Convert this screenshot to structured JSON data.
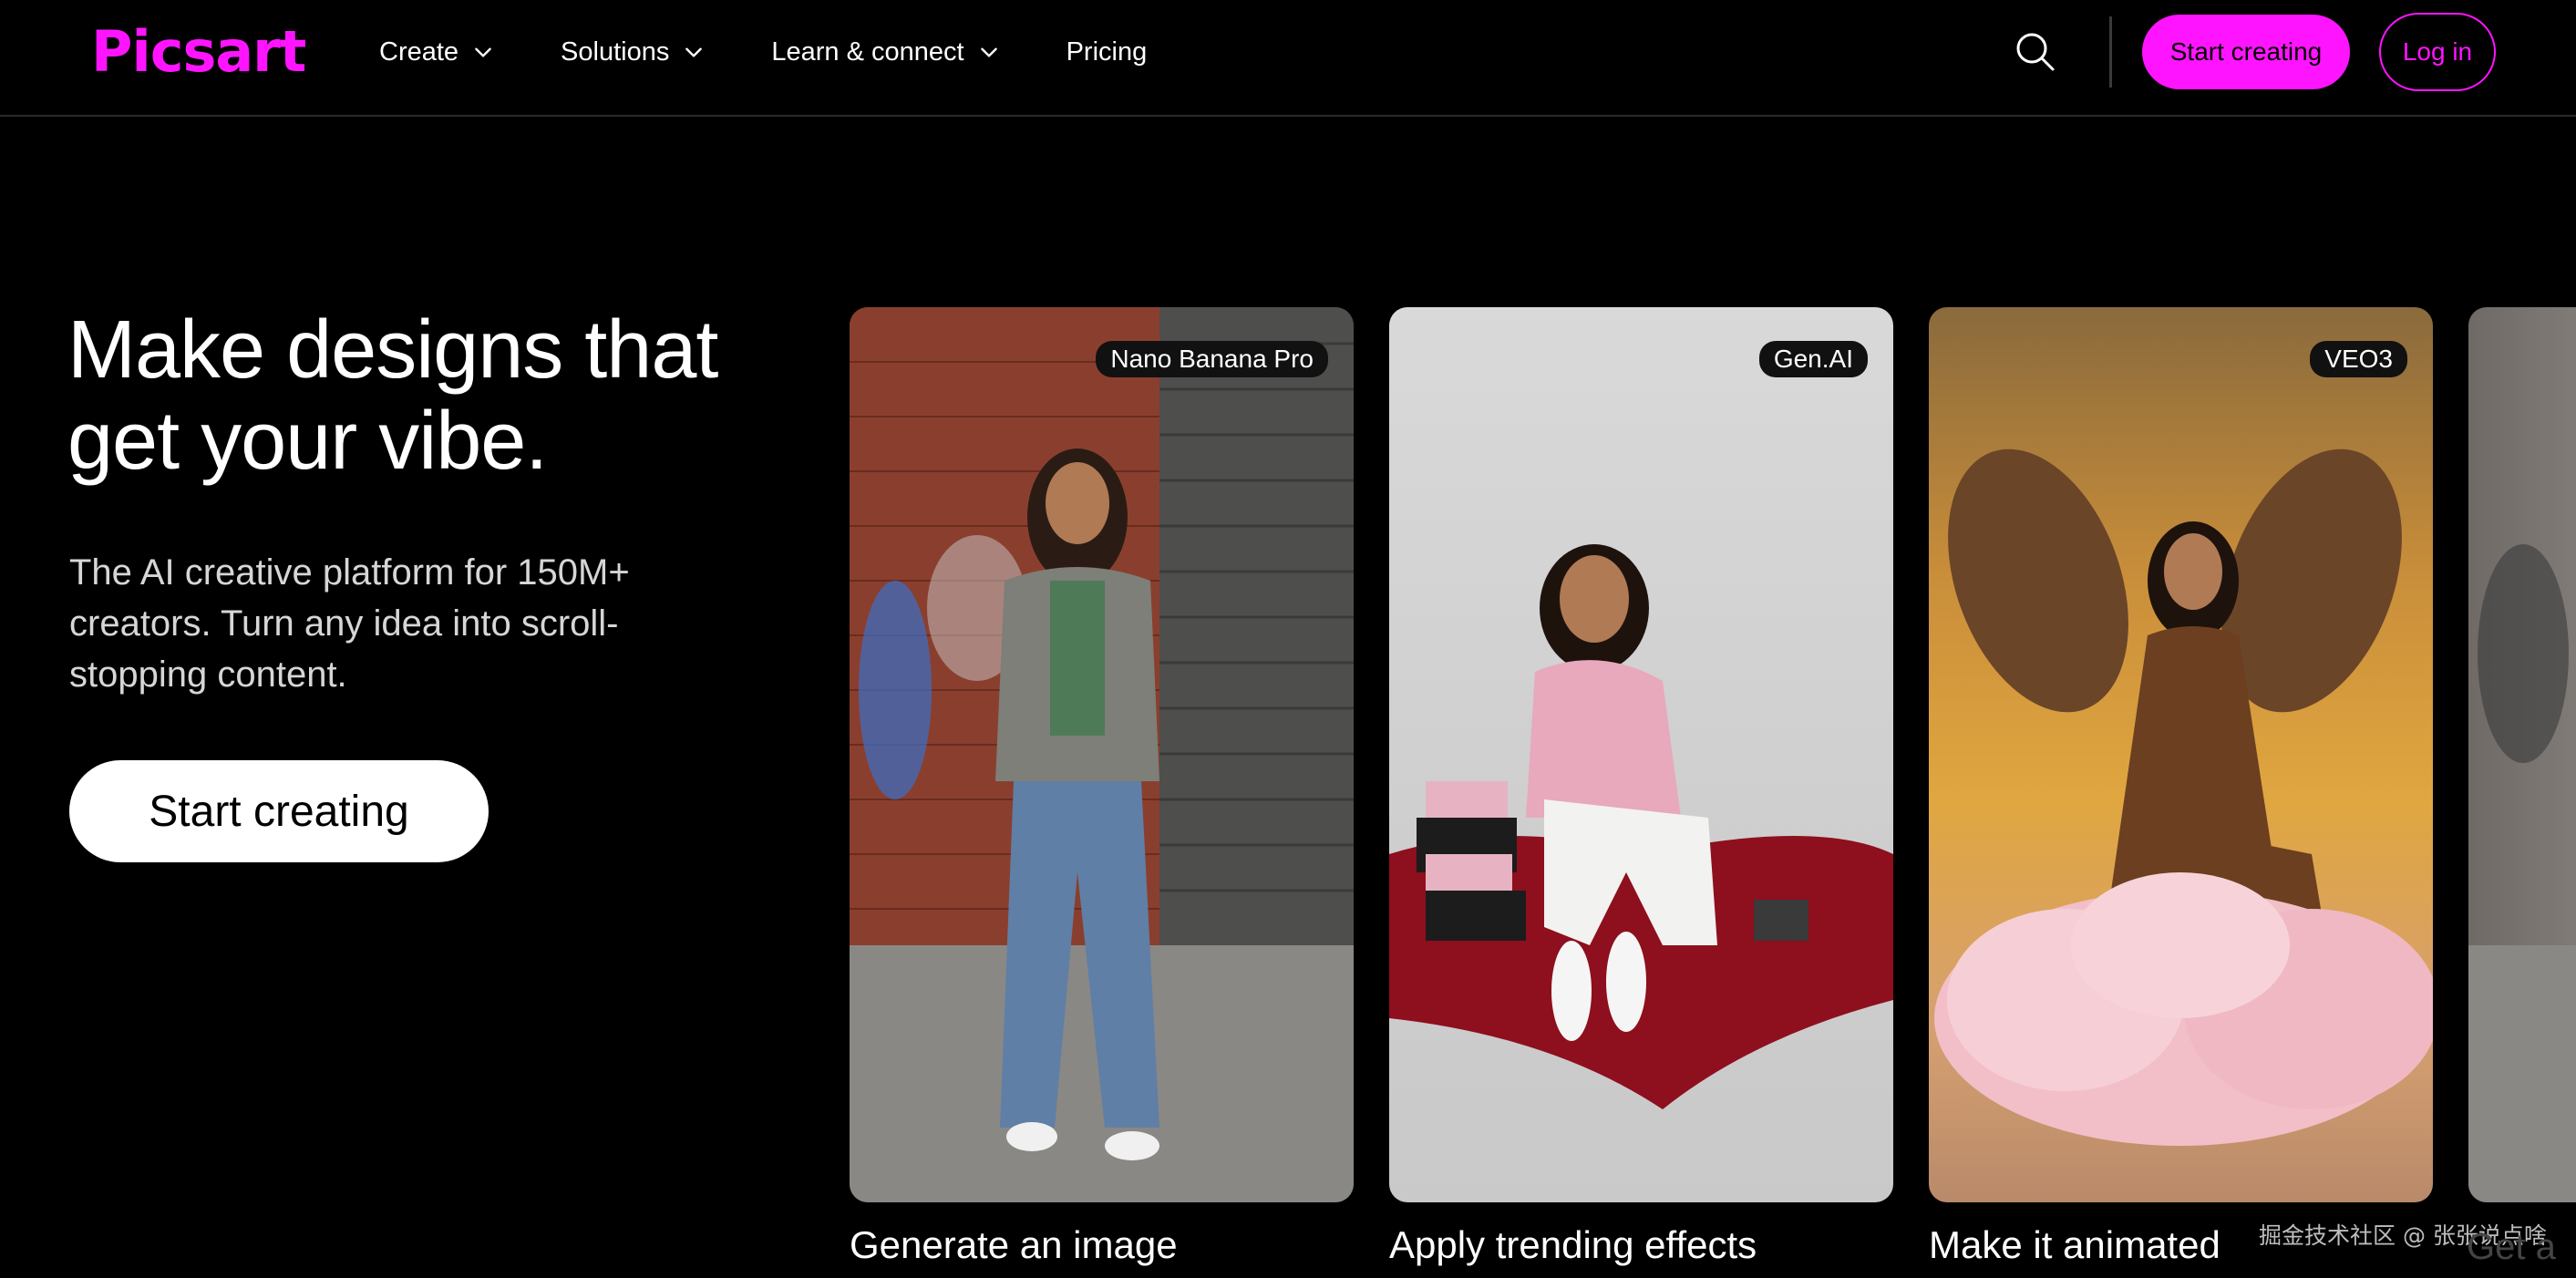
{
  "header": {
    "logo": "Picsart",
    "nav": [
      {
        "label": "Create",
        "has_dropdown": true
      },
      {
        "label": "Solutions",
        "has_dropdown": true
      },
      {
        "label": "Learn & connect",
        "has_dropdown": true
      },
      {
        "label": "Pricing",
        "has_dropdown": false
      }
    ],
    "search_icon": "search-icon",
    "start_button": "Start creating",
    "login_button": "Log in"
  },
  "hero": {
    "title_line1": "Make designs that",
    "title_line2": "get your vibe.",
    "subtitle": "The AI creative platform for 150M+ creators. Turn any idea into scroll-stopping content.",
    "cta": "Start creating"
  },
  "cards": [
    {
      "badge": "Nano Banana Pro",
      "label": "Generate an image"
    },
    {
      "badge": "Gen.AI",
      "label": "Apply trending effects"
    },
    {
      "badge": "VEO3",
      "label": "Make it animated"
    },
    {
      "badge": "",
      "label": "Get a"
    }
  ],
  "watermark": "掘金技术社区 @ 张张说点啥",
  "colors": {
    "brand": "#ff14ff",
    "background": "#000000",
    "text": "#ffffff"
  }
}
